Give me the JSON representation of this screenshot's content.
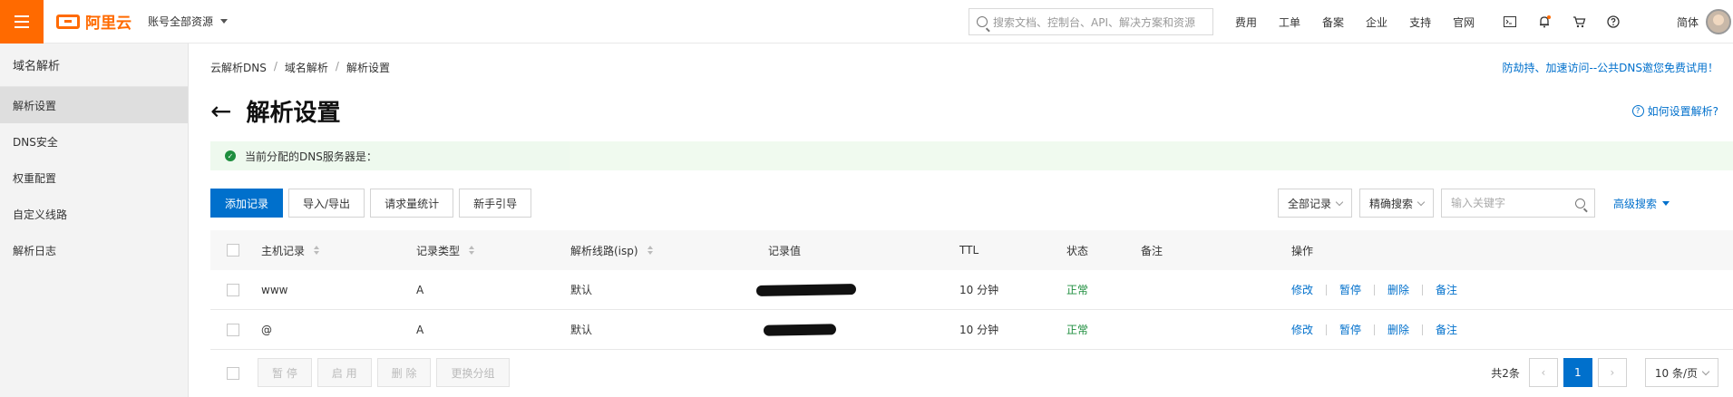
{
  "topbar": {
    "brand": "阿里云",
    "account": "账号全部资源",
    "search_placeholder": "搜索文档、控制台、API、解决方案和资源",
    "nav": [
      "费用",
      "工单",
      "备案",
      "企业",
      "支持",
      "官网"
    ],
    "lang": "简体"
  },
  "sidebar": {
    "title": "域名解析",
    "items": [
      {
        "label": "解析设置"
      },
      {
        "label": "DNS安全"
      },
      {
        "label": "权重配置"
      },
      {
        "label": "自定义线路"
      },
      {
        "label": "解析日志"
      }
    ]
  },
  "breadcrumb": [
    "云解析DNS",
    "域名解析",
    "解析设置"
  ],
  "promo": "防劫持、加速访问--公共DNS邀您免费试用！",
  "page_title": "解析设置",
  "help_link": "如何设置解析?",
  "dns_banner": "当前分配的DNS服务器是：",
  "toolbar": {
    "add": "添加记录",
    "import_export": "导入/导出",
    "request_stats": "请求量统计",
    "guide": "新手引导"
  },
  "filters": {
    "all_records": "全部记录",
    "exact_search": "精确搜索",
    "keyword_placeholder": "输入关键字",
    "advanced": "高级搜索"
  },
  "table": {
    "headers": {
      "host": "主机记录",
      "type": "记录类型",
      "line": "解析线路(isp)",
      "value": "记录值",
      "ttl": "TTL",
      "status": "状态",
      "remark": "备注",
      "ops": "操作"
    },
    "rows": [
      {
        "host": "www",
        "type": "A",
        "line": "默认",
        "ttl": "10 分钟",
        "status": "正常"
      },
      {
        "host": "@",
        "type": "A",
        "line": "默认",
        "ttl": "10 分钟",
        "status": "正常"
      }
    ],
    "row_ops": [
      "修改",
      "暂停",
      "删除",
      "备注"
    ]
  },
  "footer": {
    "pause": "暂 停",
    "enable": "启 用",
    "delete": "删 除",
    "change_group": "更换分组",
    "total": "共2条",
    "page": "1",
    "page_size": "10 条/页"
  },
  "colors": {
    "brand": "#ff6a00",
    "primary": "#0070cc",
    "success": "#1e8e3e"
  }
}
